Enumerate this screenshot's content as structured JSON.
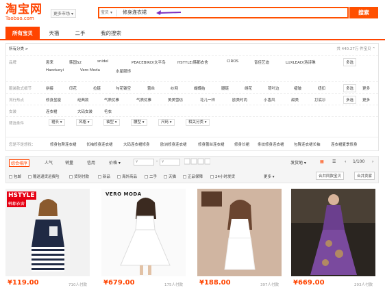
{
  "header": {
    "logo_cn": "淘宝网",
    "logo_en": "Taobao.com",
    "market_label": "更多市场",
    "search_scope": "宝贝",
    "search_query": "修身连衣裙",
    "search_button": "搜索"
  },
  "tabs": [
    "所有宝贝",
    "天猫",
    "二手",
    "我的搜索"
  ],
  "panel": {
    "breadcrumb": "所有分类 >",
    "result_count": "共 440.27万 件宝贝"
  },
  "filters": [
    {
      "label": "品牌",
      "items": [
        "恩来",
        "韩国S2",
        "snidel",
        "PEACEBIRD/太平鸟",
        "HSTYLE/韩都衣舍",
        "CIROS",
        "音佳艺迪",
        "LUXLEAD/洛诗琳",
        "Haoduoyi",
        "Vero Moda",
        "水星服饰"
      ]
    },
    {
      "label": "服装款式细节",
      "items": [
        "拼接",
        "印花",
        "拉链",
        "勾花镂空",
        "蕾丝",
        "纱网",
        "蝴蝶结",
        "腿链",
        "绣花",
        "荷叶边",
        "褶皱",
        "纽扣"
      ]
    },
    {
      "label": "流行热点",
      "items": [
        "修身显瘦",
        "经典款",
        "气质优雅",
        "气质优雅",
        "美美雪纺",
        "花儿一样",
        "欧美时尚",
        "小香风",
        "甜美",
        "打底衫"
      ]
    },
    {
      "label": "女装",
      "items": [
        "连衣裙",
        "大码女装",
        "毛衣"
      ]
    }
  ],
  "filter_more": "多选",
  "filter_more2": "更多",
  "screen_label": "筛选条件",
  "dropdowns": [
    "裙长",
    "风格",
    "袖型",
    "腰型",
    "尺码",
    "相关分类"
  ],
  "suggest_label": "您是不是想找：",
  "suggestions": [
    "修身包臀连衣裙",
    "长袖修身连衣裙",
    "大码连衣裙修身",
    "欧洲修身连衣裙",
    "修身蕾丝连衣裙",
    "修身长裙",
    "条纹修身连衣裙",
    "包臀连衣裙长袖",
    "连衣裙夏季修身"
  ],
  "sort": {
    "items": [
      "综合排序",
      "人气",
      "销量",
      "信用",
      "价格"
    ],
    "price_from": "¥",
    "price_to": "¥",
    "shipping": "发货地",
    "page": "1/100",
    "checks": [
      "包邮",
      "赠送退货运费险",
      "货到付款",
      "新品",
      "海外商品",
      "二手",
      "天猫",
      "正品保障",
      "24小时发货"
    ],
    "more": "更多",
    "compare_btn": "合并同款宝贝",
    "seller_btn": "合并卖家"
  },
  "products": [
    {
      "brand": "HSTYLE",
      "brand_sub": "韩都衣舍",
      "price": "¥119.00",
      "sold": "710人付款"
    },
    {
      "brand": "VERO MODA",
      "brand_sub": "",
      "price": "¥679.00",
      "sold": "175人付款"
    },
    {
      "brand": "",
      "brand_sub": "",
      "price": "¥188.00",
      "sold": "397人付款"
    },
    {
      "brand": "",
      "brand_sub": "",
      "price": "¥669.00",
      "sold": "293人付款"
    }
  ],
  "colors": {
    "accent": "#ff4400",
    "search_border": "#ff5000"
  }
}
